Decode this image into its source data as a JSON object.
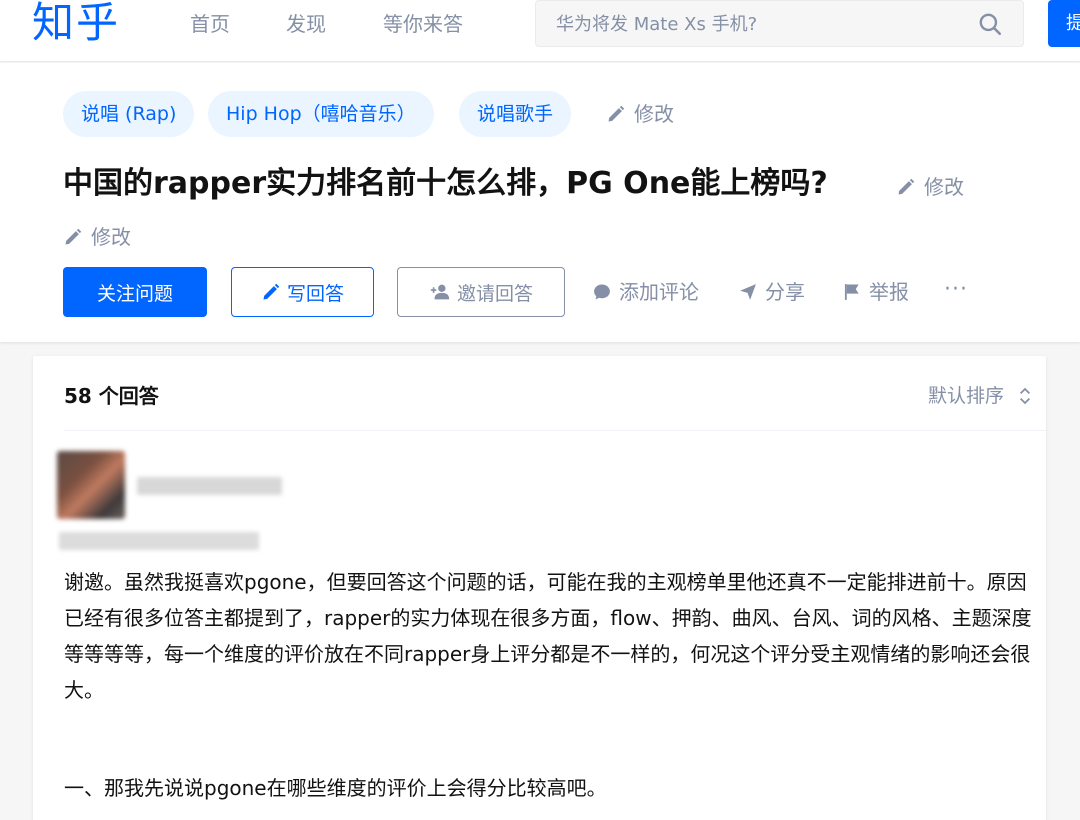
{
  "header": {
    "logo": "知乎",
    "nav": [
      "首页",
      "发现",
      "等你来答"
    ],
    "search_placeholder": "华为将发 Mate Xs 手机?",
    "ask_label": "提问"
  },
  "question": {
    "tags": [
      "说唱 (Rap)",
      "Hip Hop（嘻哈音乐）",
      "说唱歌手"
    ],
    "edit_label": "修改",
    "title": "中国的rapper实力排名前十怎么排，PG One能上榜吗?",
    "buttons": {
      "follow": "关注问题",
      "write": "写回答",
      "invite": "邀请回答"
    },
    "actions": {
      "comment": "添加评论",
      "share": "分享",
      "report": "举报",
      "more": "···"
    }
  },
  "answers": {
    "count_label": "58 个回答",
    "sort_label": "默认排序",
    "first_answer": {
      "paragraph1": "谢邀。虽然我挺喜欢pgone，但要回答这个问题的话，可能在我的主观榜单里他还真不一定能排进前十。原因已经有很多位答主都提到了，rapper的实力体现在很多方面，flow、押韵、曲风、台风、词的风格、主题深度等等等等，每一个维度的评价放在不同rapper身上评分都是不一样的，何况这个评分受主观情绪的影响还会很大。",
      "paragraph2": "一、那我先说说pgone在哪些维度的评价上会得分比较高吧。"
    }
  },
  "colors": {
    "brand": "#0066ff",
    "muted": "#8590a6",
    "tag_bg": "#ebf5ff"
  }
}
